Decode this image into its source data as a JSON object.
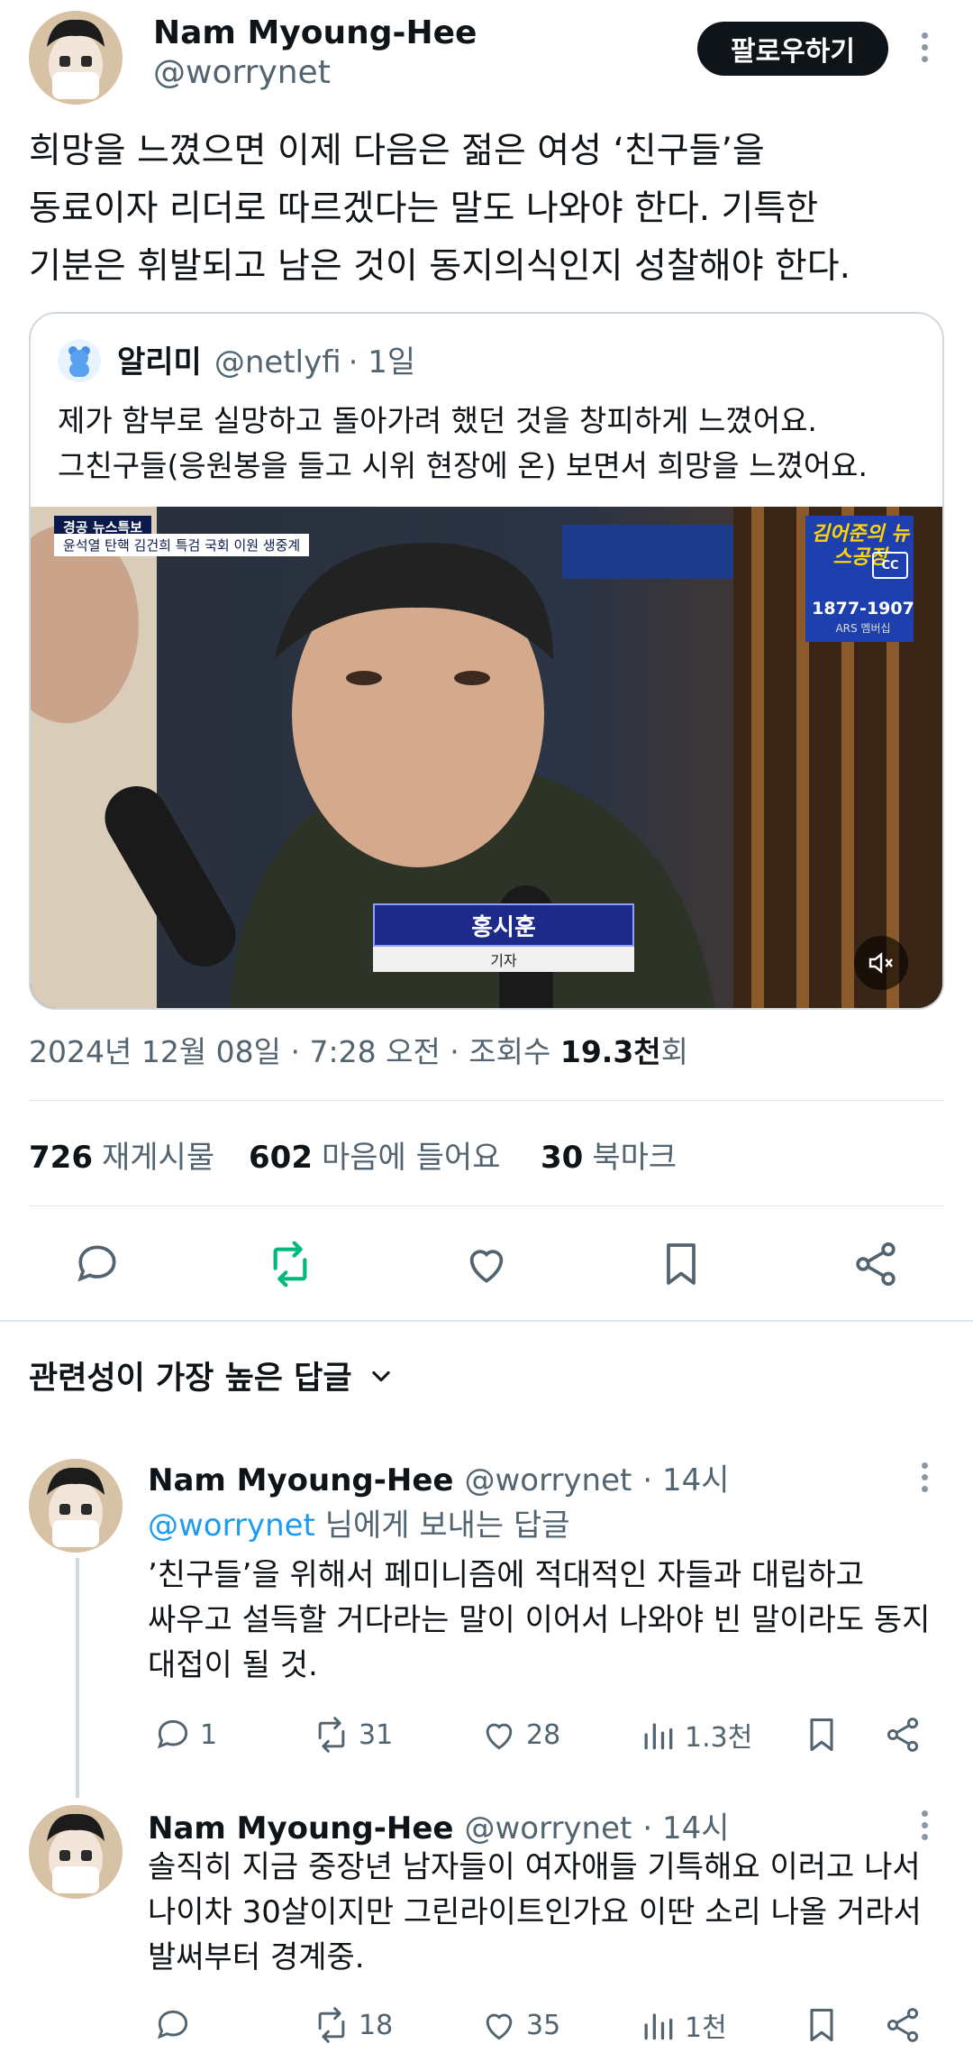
{
  "main_tweet": {
    "author_name": "Nam Myoung-Hee",
    "author_handle": "@worrynet",
    "follow_label": "팔로우하기",
    "text": "희망을 느꼈으면 이제 다음은 젊은 여성 ‘친구들’을\n동료이자 리더로 따르겠다는 말도 나와야 한다. 기특한\n기분은 휘발되고 남은 것이 동지의식인지 성찰해야 한다.",
    "timestamp": "2024년 12월 08일 · 7:28 오전 · 조회수 ",
    "views": "19.3천",
    "views_suffix": "회",
    "stats": {
      "reposts_count": "726",
      "reposts_label": "재게시물",
      "likes_count": "602",
      "likes_label": "마음에 들어요",
      "bookmarks_count": "30",
      "bookmarks_label": "북마크"
    }
  },
  "quote": {
    "author_name": "알리미",
    "author_handle": "@netlyfi",
    "time": "· 1일",
    "text": "제가 함부로 실망하고 돌아가려 했던 것을 창피하게 느꼈어요.\n그친구들(응원봉을 들고 시위 현장에 온) 보면서 희망을 느꼈어요.",
    "video": {
      "top_label_1": "경공 뉴스특보",
      "top_label_2": "윤석열 탄핵 김건희 특검 국회 이원 생중계",
      "logo_text": "김어준의 뉴스공장",
      "cc_label": "CC",
      "phone": "1877-1907",
      "ars": "ARS 멤버십",
      "lower_third_name": "홍시훈",
      "lower_third_title": "기자"
    }
  },
  "replies_sort": {
    "label": "관련성이 가장 높은 답글"
  },
  "replies": [
    {
      "author_name": "Nam Myoung-Hee",
      "author_handle": "@worrynet",
      "time": "· 14시",
      "reply_to_handle": "@worrynet",
      "reply_to_suffix": " 님에게 보내는 답글",
      "text": "’친구들’을 위해서 페미니즘에 적대적인 자들과 대립하고\n싸우고 설득할 거다라는 말이 이어서 나와야 빈 말이라도 동지\n대접이 될 것.",
      "replies": "1",
      "reposts": "31",
      "likes": "28",
      "views": "1.3천"
    },
    {
      "author_name": "Nam Myoung-Hee",
      "author_handle": "@worrynet",
      "time": "· 14시",
      "text": "솔직히 지금 중장년 남자들이 여자애들 기특해요 이러고 나서\n나이차 30살이지만 그린라이트인가요 이딴 소리 나올 거라서\n발써부터 경계중.",
      "replies": "",
      "reposts": "18",
      "likes": "35",
      "views": "1천"
    }
  ],
  "colors": {
    "accent": "#1d9bf0",
    "repost_active": "#00ba7c",
    "text": "#0f1419",
    "secondary": "#536471"
  }
}
